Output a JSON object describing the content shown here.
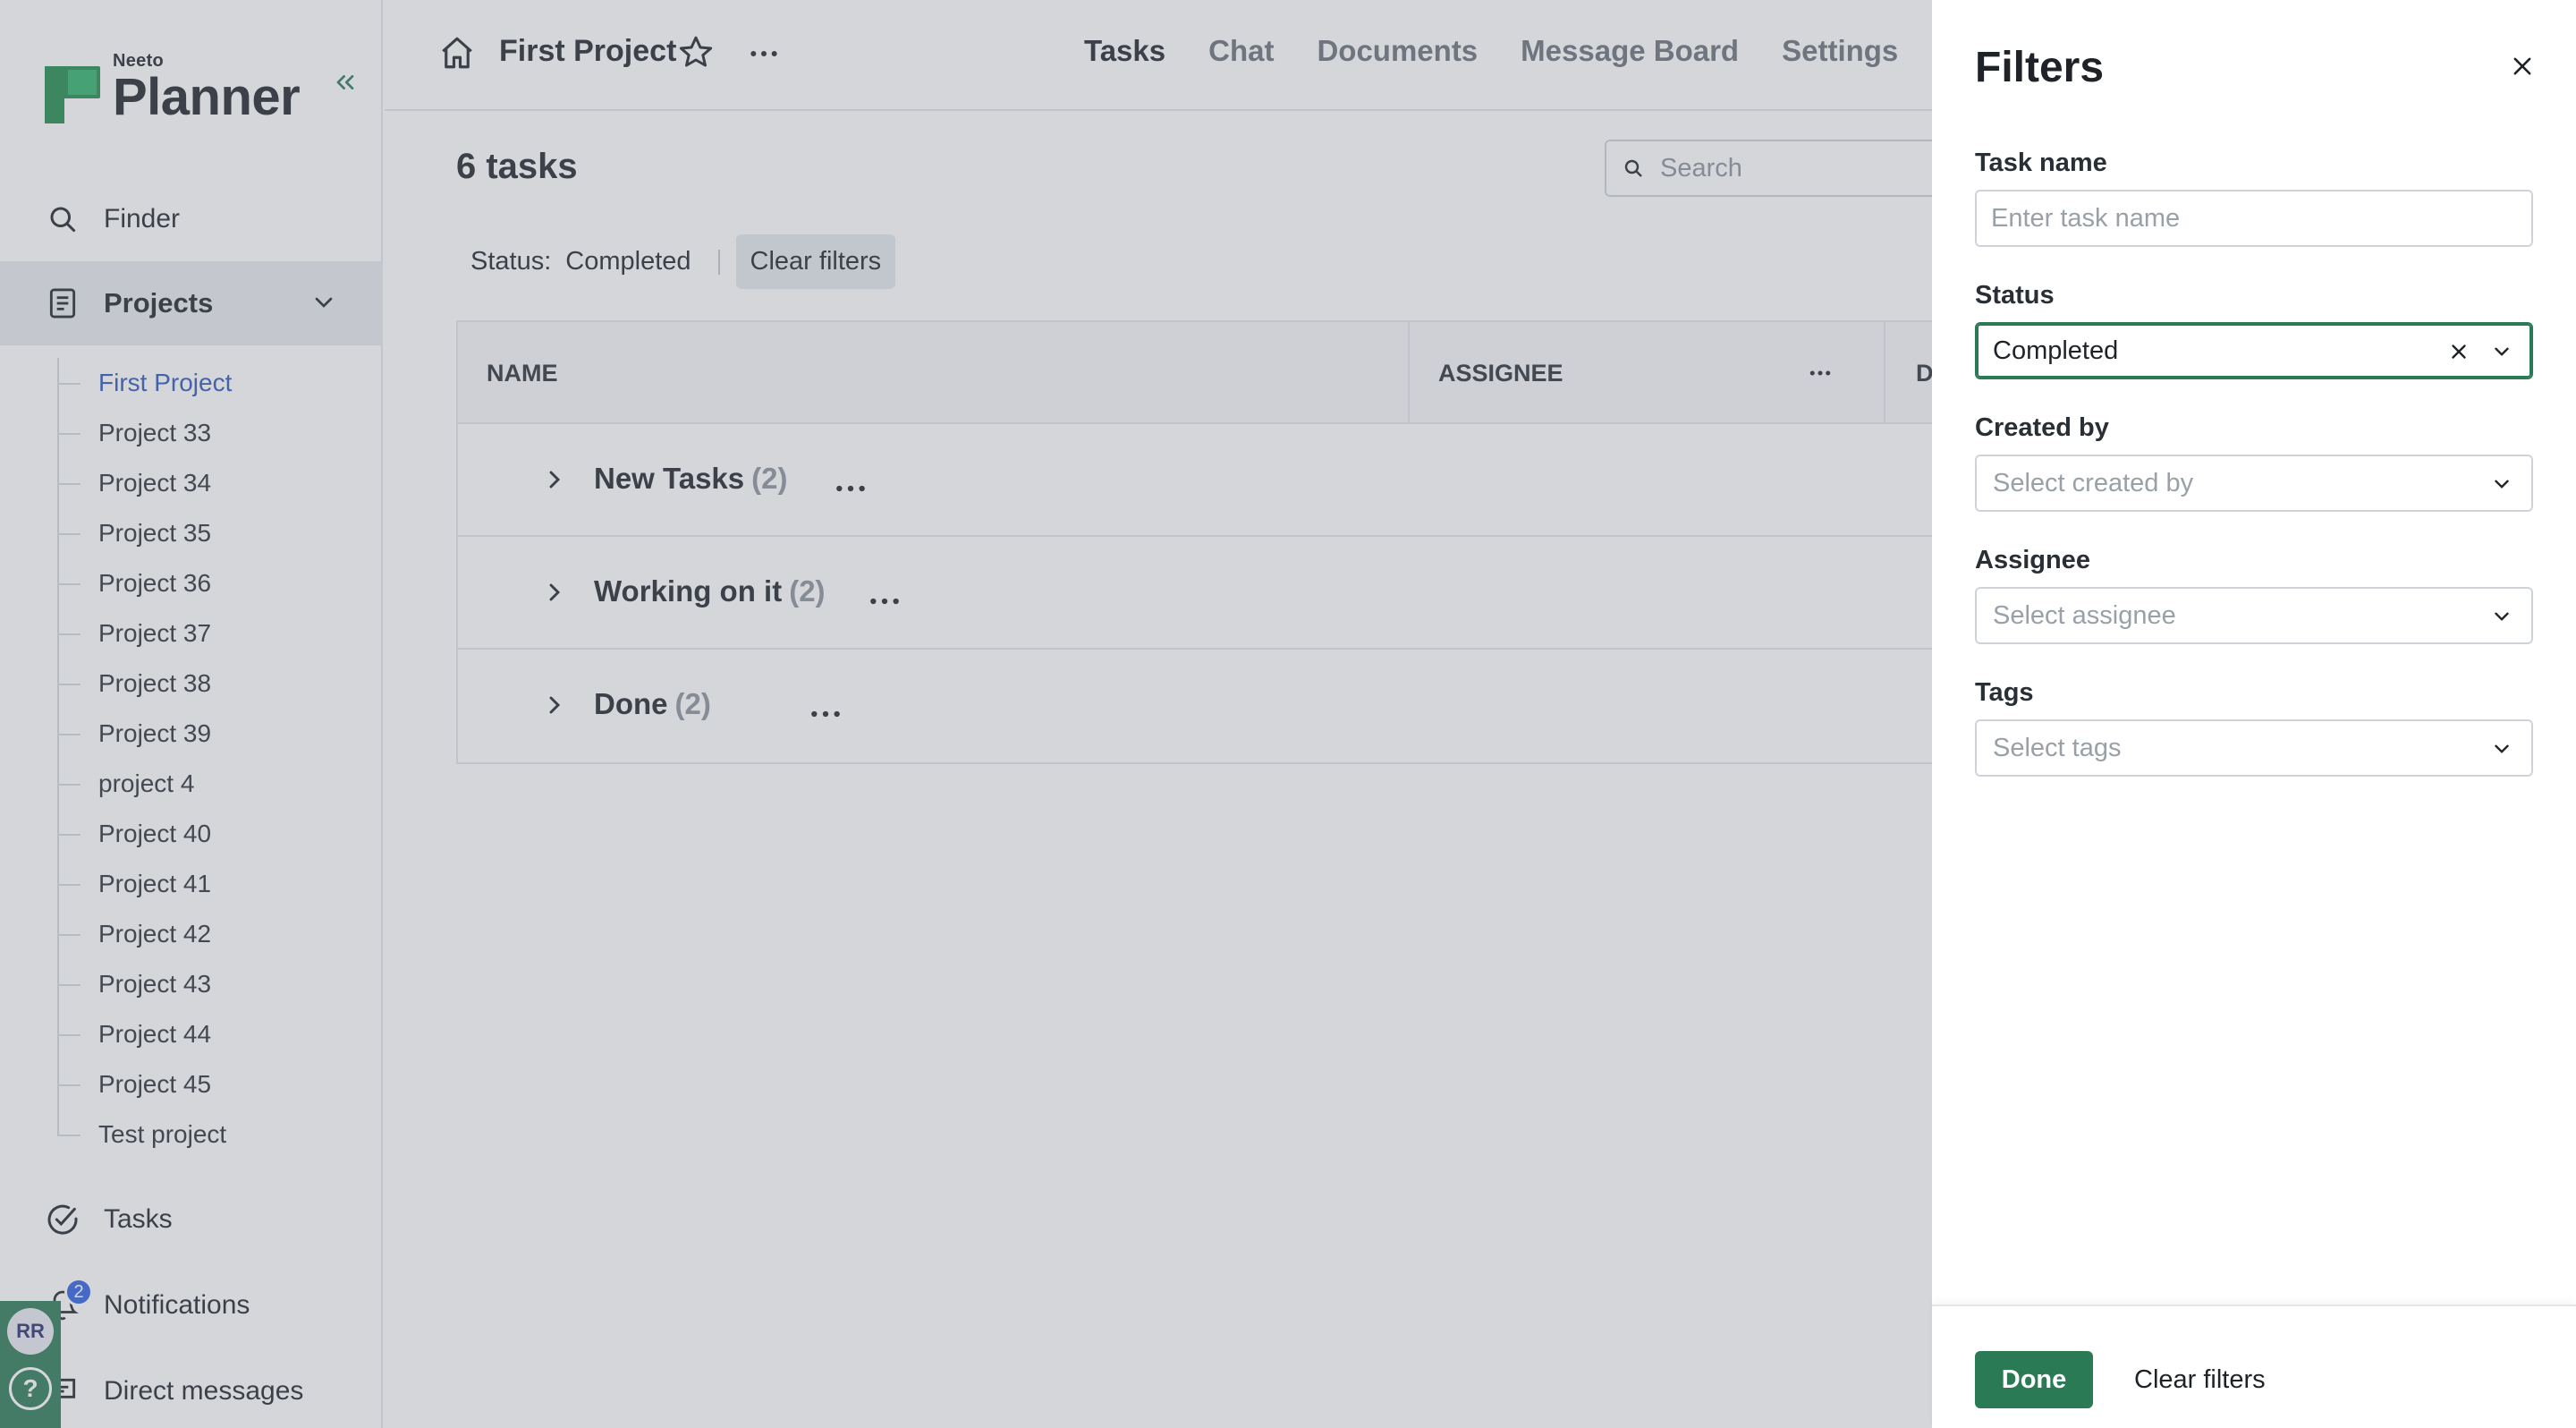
{
  "app": {
    "logo_small": "Neeto",
    "logo_big": "Planner"
  },
  "sidebar": {
    "finder": "Finder",
    "projects": "Projects",
    "project_items": [
      "First Project",
      "Project 33",
      "Project 34",
      "Project 35",
      "Project 36",
      "Project 37",
      "Project 38",
      "Project 39",
      "project 4",
      "Project 40",
      "Project 41",
      "Project 42",
      "Project 43",
      "Project 44",
      "Project 45",
      "Test project"
    ],
    "active_project": "First Project",
    "tasks": "Tasks",
    "notifications": "Notifications",
    "notifications_count": "2",
    "direct_messages": "Direct messages",
    "avatar_initials": "RR",
    "help": "?"
  },
  "header": {
    "project_title": "First Project",
    "tabs": [
      "Tasks",
      "Chat",
      "Documents",
      "Message Board",
      "Settings"
    ],
    "active_tab": "Tasks"
  },
  "main": {
    "task_count": "6 tasks",
    "search_placeholder": "Search",
    "filter_label": "Status:",
    "filter_value": "Completed",
    "clear_filters": "Clear filters",
    "columns": [
      "NAME",
      "ASSIGNEE",
      "D"
    ],
    "groups": [
      {
        "label": "New Tasks",
        "count": "(2)"
      },
      {
        "label": "Working on it",
        "count": "(2)"
      },
      {
        "label": "Done",
        "count": "(2)"
      }
    ]
  },
  "filters_panel": {
    "title": "Filters",
    "task_name_label": "Task name",
    "task_name_placeholder": "Enter task name",
    "status_label": "Status",
    "status_value": "Completed",
    "created_by_label": "Created by",
    "created_by_placeholder": "Select created by",
    "assignee_label": "Assignee",
    "assignee_placeholder": "Select assignee",
    "tags_label": "Tags",
    "tags_placeholder": "Select tags",
    "done_button": "Done",
    "clear_button": "Clear filters"
  },
  "colors": {
    "brand": "#2b7a56",
    "active_link": "#2f55b5",
    "badge": "#2f5fe0"
  }
}
